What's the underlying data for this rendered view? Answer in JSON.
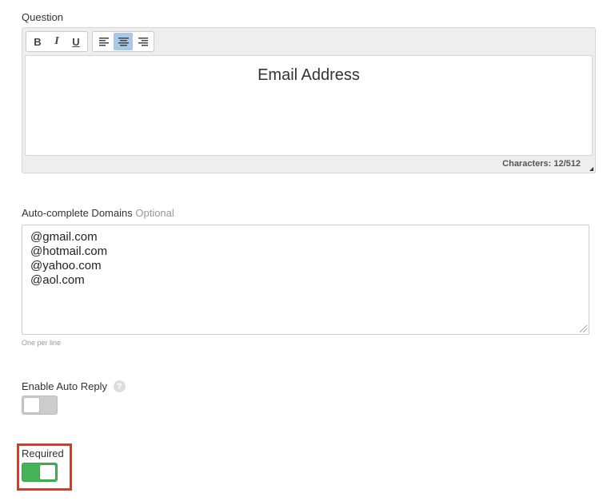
{
  "question": {
    "label": "Question",
    "toolbar": {
      "bold_label": "B",
      "italic_label": "I",
      "underline_label": "U",
      "active_alignment": "center"
    },
    "content": "Email Address",
    "char_count": "Characters: 12/512"
  },
  "domains": {
    "label": "Auto-complete Domains",
    "optional_label": "Optional",
    "lines": [
      "@gmail.com",
      "@hotmail.com",
      "@yahoo.com",
      "@aol.com"
    ],
    "helper": "One per line"
  },
  "auto_reply": {
    "label": "Enable Auto Reply",
    "help_glyph": "?",
    "enabled": false
  },
  "required": {
    "label": "Required",
    "enabled": true
  },
  "colors": {
    "toggle_on": "#44b556",
    "toggle_off": "#cccccc",
    "highlight": "#e8321e",
    "active_tool": "#a8c8e8"
  }
}
